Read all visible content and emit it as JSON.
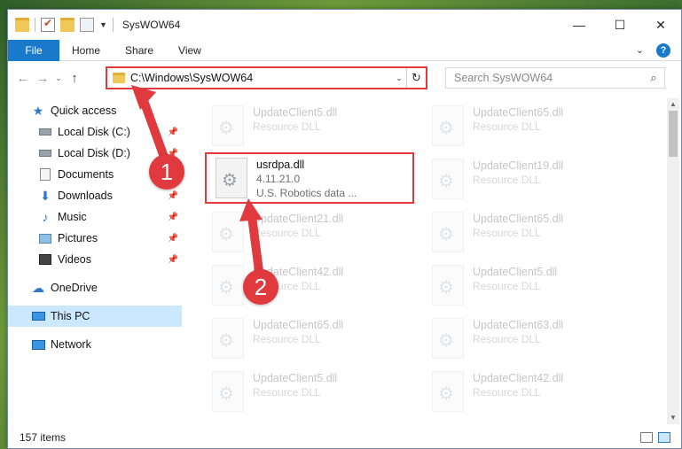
{
  "window": {
    "title": "SysWOW64",
    "controls": {
      "minimize": "—",
      "maximize": "☐",
      "close": "✕"
    }
  },
  "ribbon": {
    "tabs": [
      "File",
      "Home",
      "Share",
      "View"
    ],
    "expand": "⌄",
    "help": "?"
  },
  "nav": {
    "back": "←",
    "forward": "→",
    "recent": "⌄",
    "up": "↑",
    "address": "C:\\Windows\\SysWOW64",
    "dropdown": "⌄",
    "refresh": "↻",
    "search_placeholder": "Search SysWOW64",
    "search_icon": "⌕"
  },
  "sidebar": {
    "items": [
      {
        "label": "Quick access",
        "icon": "star-icon",
        "pinned": false
      },
      {
        "label": "Local Disk (C:)",
        "icon": "drive-icon",
        "pinned": true
      },
      {
        "label": "Local Disk (D:)",
        "icon": "drive-icon",
        "pinned": true
      },
      {
        "label": "Documents",
        "icon": "documents-icon",
        "pinned": true
      },
      {
        "label": "Downloads",
        "icon": "download-icon",
        "pinned": true
      },
      {
        "label": "Music",
        "icon": "music-icon",
        "pinned": true
      },
      {
        "label": "Pictures",
        "icon": "pictures-icon",
        "pinned": true
      },
      {
        "label": "Videos",
        "icon": "videos-icon",
        "pinned": true
      },
      {
        "label": "OneDrive",
        "icon": "cloud-icon",
        "pinned": false
      },
      {
        "label": "This PC",
        "icon": "computer-icon",
        "pinned": false,
        "selected": true
      },
      {
        "label": "Network",
        "icon": "network-icon",
        "pinned": false
      }
    ]
  },
  "files": {
    "left": [
      {
        "name": "UpdateClient5.dll",
        "sub": "Resource DLL"
      },
      {
        "name": "usrdpa.dll",
        "sub": "4.11.21.0",
        "sub2": "U.S. Robotics data ...",
        "highlight": true
      },
      {
        "name": "UpdateClient21.dll",
        "sub": "Resource DLL"
      },
      {
        "name": "UpdateClient42.dll",
        "sub": "Resource DLL"
      },
      {
        "name": "UpdateClient65.dll",
        "sub": "Resource DLL"
      },
      {
        "name": "UpdateClient5.dll",
        "sub": "Resource DLL"
      }
    ],
    "right": [
      {
        "name": "UpdateClient65.dll",
        "sub": "Resource DLL"
      },
      {
        "name": "UpdateClient19.dll",
        "sub": "Resource DLL"
      },
      {
        "name": "UpdateClient65.dll",
        "sub": "Resource DLL"
      },
      {
        "name": "UpdateClient5.dll",
        "sub": "Resource DLL"
      },
      {
        "name": "UpdateClient63.dll",
        "sub": "Resource DLL"
      },
      {
        "name": "UpdateClient42.dll",
        "sub": "Resource DLL"
      }
    ]
  },
  "status": {
    "count": "157 items"
  },
  "annotations": {
    "step1": "1",
    "step2": "2",
    "color": "#e0393e"
  }
}
